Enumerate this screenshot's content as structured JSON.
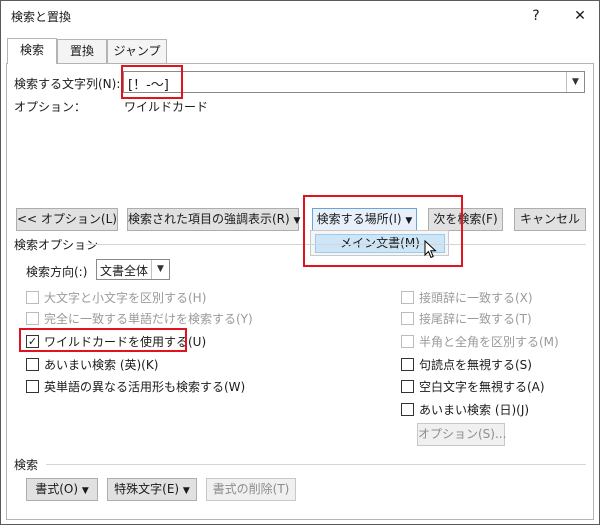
{
  "window": {
    "title": "検索と置換",
    "help_glyph": "?",
    "close_glyph": "✕"
  },
  "tabs": [
    {
      "label": "検索"
    },
    {
      "label": "置換"
    },
    {
      "label": "ジャンプ"
    }
  ],
  "search": {
    "label": "検索する文字列(N):",
    "value": "[！-～]",
    "options_label": "オプション：",
    "options_value": "ワイルドカード"
  },
  "buttons": {
    "less_options": "<< オプション(L)",
    "highlight": "検索された項目の強調表示(R)",
    "find_in": "検索する場所(I)",
    "find_next": "次を検索(F)",
    "cancel": "キャンセル"
  },
  "find_in_menu": {
    "items": [
      {
        "label": "メイン文書(M)"
      }
    ]
  },
  "search_options": {
    "heading": "検索オプション",
    "direction_label": "検索方向(:)",
    "direction_value": "文書全体"
  },
  "checkboxes_left": [
    {
      "label": "大文字と小文字を区別する(H)",
      "checked": false,
      "disabled": true
    },
    {
      "label": "完全に一致する単語だけを検索する(Y)",
      "checked": false,
      "disabled": true
    },
    {
      "label": "ワイルドカードを使用する(U)",
      "checked": true,
      "disabled": false
    },
    {
      "label": "あいまい検索 (英)(K)",
      "checked": false,
      "disabled": false
    },
    {
      "label": "英単語の異なる活用形も検索する(W)",
      "checked": false,
      "disabled": false
    }
  ],
  "checkboxes_right": [
    {
      "label": "接頭辞に一致する(X)",
      "checked": false,
      "disabled": true
    },
    {
      "label": "接尾辞に一致する(T)",
      "checked": false,
      "disabled": true
    },
    {
      "label": "半角と全角を区別する(M)",
      "checked": false,
      "disabled": true
    },
    {
      "label": "句読点を無視する(S)",
      "checked": false,
      "disabled": false
    },
    {
      "label": "空白文字を無視する(A)",
      "checked": false,
      "disabled": false
    },
    {
      "label": "あいまい検索 (日)(J)",
      "checked": false,
      "disabled": false
    }
  ],
  "fuzzy_options_button": "オプション(S)...",
  "bottom": {
    "heading": "検索",
    "format_button": "書式(O)",
    "special_button": "特殊文字(E)",
    "clear_format_button": "書式の削除(T)"
  },
  "icons": {
    "dropdown": "chevron-down-icon",
    "cursor": "mouse-pointer-icon",
    "check": "check-icon"
  },
  "colors": {
    "highlight_box": "#e0141e",
    "menu_selection": "#cde6f7"
  }
}
